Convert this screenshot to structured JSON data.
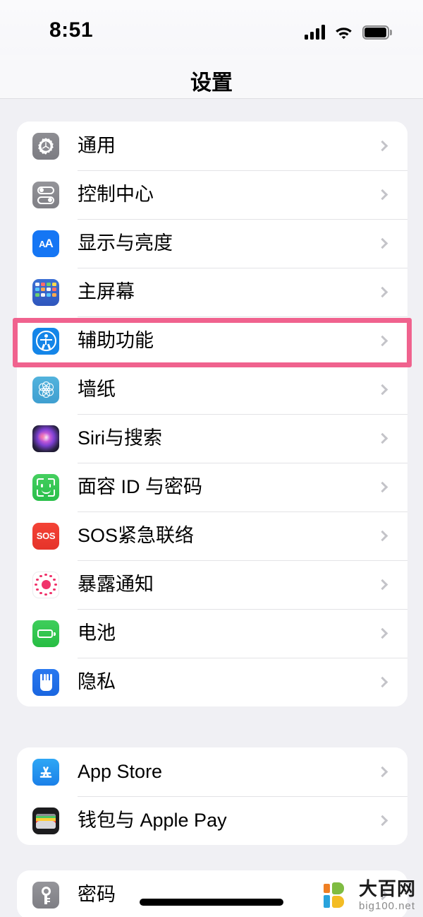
{
  "status_bar": {
    "time": "8:51",
    "signal_icon": "cellular-signal-icon",
    "signal_bars_filled": 4,
    "wifi_icon": "wifi-icon",
    "battery_icon": "battery-icon",
    "battery_full": true
  },
  "header": {
    "title": "设置"
  },
  "highlight": {
    "target_row": "辅助功能",
    "color": "#f0628e"
  },
  "groups": [
    {
      "id": "group-0",
      "rows": [
        {
          "label": "通用",
          "icon": "settings-gear-icon",
          "chevron": "chevron-right-icon"
        },
        {
          "label": "控制中心",
          "icon": "control-center-icon",
          "chevron": "chevron-right-icon"
        },
        {
          "label": "显示与亮度",
          "icon": "display-brightness-icon",
          "chevron": "chevron-right-icon"
        },
        {
          "label": "主屏幕",
          "icon": "home-screen-icon",
          "chevron": "chevron-right-icon"
        },
        {
          "label": "辅助功能",
          "icon": "accessibility-icon",
          "chevron": "chevron-right-icon"
        },
        {
          "label": "墙纸",
          "icon": "wallpaper-icon",
          "chevron": "chevron-right-icon"
        },
        {
          "label": "Siri与搜索",
          "icon": "siri-search-icon",
          "chevron": "chevron-right-icon"
        },
        {
          "label": "面容 ID 与密码",
          "icon": "face-id-icon",
          "chevron": "chevron-right-icon"
        },
        {
          "label": "SOS紧急联络",
          "icon": "emergency-sos-icon",
          "chevron": "chevron-right-icon"
        },
        {
          "label": "暴露通知",
          "icon": "exposure-notifications-icon",
          "chevron": "chevron-right-icon"
        },
        {
          "label": "电池",
          "icon": "battery-settings-icon",
          "chevron": "chevron-right-icon"
        },
        {
          "label": "隐私",
          "icon": "privacy-hand-icon",
          "chevron": "chevron-right-icon"
        }
      ]
    },
    {
      "id": "group-1",
      "rows": [
        {
          "label": "App Store",
          "icon": "app-store-icon",
          "chevron": "chevron-right-icon"
        },
        {
          "label": "钱包与 Apple Pay",
          "icon": "wallet-icon",
          "chevron": "chevron-right-icon"
        }
      ]
    },
    {
      "id": "group-2",
      "rows": [
        {
          "label": "密码",
          "icon": "passwords-key-icon",
          "chevron": "chevron-right-icon"
        }
      ]
    }
  ],
  "watermark": {
    "name_cn": "大百网",
    "name_en": "big100.net"
  }
}
